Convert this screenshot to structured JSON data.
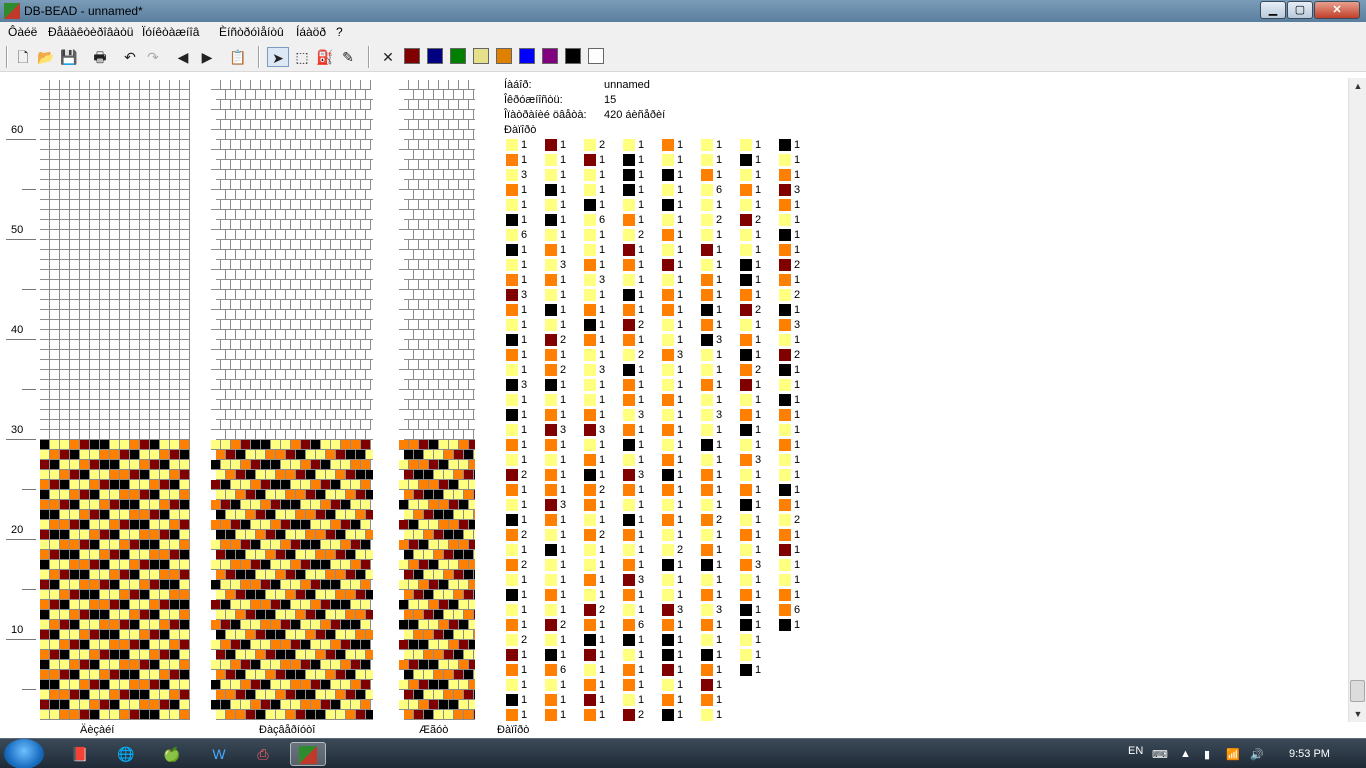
{
  "window": {
    "title": "DB-BEAD - unnamed*",
    "min_label": "▁",
    "max_label": "▢",
    "close_label": "✕"
  },
  "menu": [
    "Ôàéë",
    "Ðåäàêòèðîâàòü",
    "Ïóíêòàæíîâ",
    "Èíñòðóìåíòû",
    "Íáàöð",
    "?"
  ],
  "toolbar_icons": [
    "new-icon",
    "open-icon",
    "save-icon",
    "print-icon",
    "undo-icon",
    "redo-icon",
    "prev-icon",
    "next-icon",
    "paste-icon",
    "pointer-icon",
    "select-icon",
    "fill-icon",
    "eyedropper-icon",
    "clear-icon"
  ],
  "palette": [
    "#800000",
    "#000080",
    "#008000",
    "#e6e08a",
    "#e08000",
    "#0000ff",
    "#800080",
    "#000000",
    "#ffffff"
  ],
  "ruler": {
    "labels": [
      "60",
      "50",
      "40",
      "30",
      "20",
      "10"
    ]
  },
  "panels": {
    "draft_label": "Äèçàéí",
    "corrected_label": "Ðàçâåðíóòî",
    "rope_label": "Æãóò",
    "list_label": "Ðàïîðò"
  },
  "info": {
    "file_label": "Íàáîð:",
    "file_value": "unnamed",
    "circ_label": "Îêðóæíîñòü:",
    "circ_value": "15",
    "repeat_label": "Îïàòðàíèé öâåòà:",
    "repeat_value": "420 áèñåðèí",
    "list_header": "Ðàïîðò"
  },
  "colors": {
    "Y": "#ffff80",
    "O": "#ff8000",
    "R": "#800000",
    "K": "#000000"
  },
  "bead_list": [
    [
      [
        "Y",
        "1"
      ],
      [
        "O",
        "1"
      ],
      [
        "Y",
        "3"
      ],
      [
        "O",
        "1"
      ],
      [
        "Y",
        "1"
      ],
      [
        "K",
        "1"
      ],
      [
        "Y",
        "6"
      ],
      [
        "K",
        "1"
      ],
      [
        "Y",
        "1"
      ],
      [
        "O",
        "1"
      ],
      [
        "R",
        "3"
      ],
      [
        "O",
        "1"
      ],
      [
        "Y",
        "1"
      ],
      [
        "K",
        "1"
      ],
      [
        "O",
        "1"
      ],
      [
        "Y",
        "1"
      ],
      [
        "K",
        "3"
      ],
      [
        "Y",
        "1"
      ],
      [
        "K",
        "1"
      ],
      [
        "Y",
        "1"
      ],
      [
        "O",
        "1"
      ],
      [
        "Y",
        "1"
      ],
      [
        "R",
        "2"
      ],
      [
        "O",
        "1"
      ],
      [
        "Y",
        "1"
      ],
      [
        "K",
        "1"
      ],
      [
        "O",
        "2"
      ],
      [
        "Y",
        "1"
      ],
      [
        "O",
        "2"
      ],
      [
        "Y",
        "1"
      ],
      [
        "K",
        "1"
      ],
      [
        "Y",
        "1"
      ],
      [
        "O",
        "1"
      ],
      [
        "Y",
        "2"
      ],
      [
        "R",
        "1"
      ],
      [
        "O",
        "1"
      ],
      [
        "Y",
        "1"
      ],
      [
        "K",
        "1"
      ],
      [
        "O",
        "1"
      ]
    ],
    [
      [
        "R",
        "1"
      ],
      [
        "Y",
        "1"
      ],
      [
        "Y",
        "1"
      ],
      [
        "K",
        "1"
      ],
      [
        "Y",
        "1"
      ],
      [
        "K",
        "1"
      ],
      [
        "Y",
        "1"
      ],
      [
        "O",
        "1"
      ],
      [
        "Y",
        "3"
      ],
      [
        "O",
        "1"
      ],
      [
        "Y",
        "1"
      ],
      [
        "K",
        "1"
      ],
      [
        "Y",
        "1"
      ],
      [
        "R",
        "2"
      ],
      [
        "O",
        "1"
      ],
      [
        "O",
        "2"
      ],
      [
        "K",
        "1"
      ],
      [
        "Y",
        "1"
      ],
      [
        "O",
        "1"
      ],
      [
        "R",
        "3"
      ],
      [
        "O",
        "1"
      ],
      [
        "Y",
        "1"
      ],
      [
        "O",
        "1"
      ],
      [
        "O",
        "1"
      ],
      [
        "R",
        "3"
      ],
      [
        "O",
        "1"
      ],
      [
        "Y",
        "1"
      ],
      [
        "K",
        "1"
      ],
      [
        "Y",
        "1"
      ],
      [
        "Y",
        "1"
      ],
      [
        "O",
        "1"
      ],
      [
        "Y",
        "1"
      ],
      [
        "R",
        "2"
      ],
      [
        "Y",
        "1"
      ],
      [
        "K",
        "1"
      ],
      [
        "O",
        "6"
      ],
      [
        "Y",
        "1"
      ],
      [
        "O",
        "1"
      ],
      [
        "O",
        "1"
      ]
    ],
    [
      [
        "Y",
        "2"
      ],
      [
        "R",
        "1"
      ],
      [
        "Y",
        "1"
      ],
      [
        "Y",
        "1"
      ],
      [
        "K",
        "1"
      ],
      [
        "Y",
        "6"
      ],
      [
        "Y",
        "1"
      ],
      [
        "Y",
        "1"
      ],
      [
        "O",
        "1"
      ],
      [
        "Y",
        "3"
      ],
      [
        "Y",
        "1"
      ],
      [
        "O",
        "1"
      ],
      [
        "K",
        "1"
      ],
      [
        "O",
        "1"
      ],
      [
        "Y",
        "1"
      ],
      [
        "Y",
        "3"
      ],
      [
        "Y",
        "1"
      ],
      [
        "Y",
        "1"
      ],
      [
        "O",
        "1"
      ],
      [
        "R",
        "3"
      ],
      [
        "Y",
        "1"
      ],
      [
        "O",
        "1"
      ],
      [
        "K",
        "1"
      ],
      [
        "O",
        "2"
      ],
      [
        "O",
        "1"
      ],
      [
        "Y",
        "1"
      ],
      [
        "O",
        "2"
      ],
      [
        "Y",
        "1"
      ],
      [
        "Y",
        "1"
      ],
      [
        "O",
        "1"
      ],
      [
        "Y",
        "1"
      ],
      [
        "R",
        "2"
      ],
      [
        "O",
        "1"
      ],
      [
        "K",
        "1"
      ],
      [
        "R",
        "1"
      ],
      [
        "Y",
        "1"
      ],
      [
        "O",
        "1"
      ],
      [
        "R",
        "1"
      ],
      [
        "O",
        "1"
      ]
    ],
    [
      [
        "Y",
        "1"
      ],
      [
        "K",
        "1"
      ],
      [
        "K",
        "1"
      ],
      [
        "K",
        "1"
      ],
      [
        "Y",
        "1"
      ],
      [
        "O",
        "1"
      ],
      [
        "Y",
        "2"
      ],
      [
        "R",
        "1"
      ],
      [
        "O",
        "1"
      ],
      [
        "Y",
        "1"
      ],
      [
        "K",
        "1"
      ],
      [
        "O",
        "1"
      ],
      [
        "R",
        "2"
      ],
      [
        "O",
        "1"
      ],
      [
        "Y",
        "2"
      ],
      [
        "K",
        "1"
      ],
      [
        "O",
        "1"
      ],
      [
        "O",
        "1"
      ],
      [
        "Y",
        "3"
      ],
      [
        "O",
        "1"
      ],
      [
        "K",
        "1"
      ],
      [
        "Y",
        "1"
      ],
      [
        "R",
        "3"
      ],
      [
        "O",
        "1"
      ],
      [
        "Y",
        "1"
      ],
      [
        "K",
        "1"
      ],
      [
        "O",
        "1"
      ],
      [
        "Y",
        "1"
      ],
      [
        "O",
        "1"
      ],
      [
        "R",
        "3"
      ],
      [
        "O",
        "1"
      ],
      [
        "Y",
        "1"
      ],
      [
        "O",
        "6"
      ],
      [
        "K",
        "1"
      ],
      [
        "Y",
        "1"
      ],
      [
        "O",
        "1"
      ],
      [
        "O",
        "1"
      ],
      [
        "Y",
        "1"
      ],
      [
        "R",
        "2"
      ]
    ],
    [
      [
        "O",
        "1"
      ],
      [
        "Y",
        "1"
      ],
      [
        "K",
        "1"
      ],
      [
        "Y",
        "1"
      ],
      [
        "K",
        "1"
      ],
      [
        "Y",
        "1"
      ],
      [
        "O",
        "1"
      ],
      [
        "Y",
        "1"
      ],
      [
        "R",
        "1"
      ],
      [
        "Y",
        "1"
      ],
      [
        "O",
        "1"
      ],
      [
        "O",
        "1"
      ],
      [
        "Y",
        "1"
      ],
      [
        "Y",
        "1"
      ],
      [
        "O",
        "3"
      ],
      [
        "Y",
        "1"
      ],
      [
        "Y",
        "1"
      ],
      [
        "O",
        "1"
      ],
      [
        "Y",
        "1"
      ],
      [
        "O",
        "1"
      ],
      [
        "Y",
        "1"
      ],
      [
        "O",
        "1"
      ],
      [
        "K",
        "1"
      ],
      [
        "O",
        "1"
      ],
      [
        "Y",
        "1"
      ],
      [
        "O",
        "1"
      ],
      [
        "Y",
        "1"
      ],
      [
        "Y",
        "2"
      ],
      [
        "K",
        "1"
      ],
      [
        "Y",
        "1"
      ],
      [
        "Y",
        "1"
      ],
      [
        "R",
        "3"
      ],
      [
        "O",
        "1"
      ],
      [
        "K",
        "1"
      ],
      [
        "K",
        "1"
      ],
      [
        "R",
        "1"
      ],
      [
        "Y",
        "1"
      ],
      [
        "O",
        "1"
      ],
      [
        "K",
        "1"
      ]
    ],
    [
      [
        "Y",
        "1"
      ],
      [
        "Y",
        "1"
      ],
      [
        "O",
        "1"
      ],
      [
        "Y",
        "6"
      ],
      [
        "Y",
        "1"
      ],
      [
        "Y",
        "2"
      ],
      [
        "Y",
        "1"
      ],
      [
        "R",
        "1"
      ],
      [
        "Y",
        "1"
      ],
      [
        "O",
        "1"
      ],
      [
        "O",
        "1"
      ],
      [
        "K",
        "1"
      ],
      [
        "O",
        "1"
      ],
      [
        "K",
        "3"
      ],
      [
        "Y",
        "1"
      ],
      [
        "Y",
        "1"
      ],
      [
        "O",
        "1"
      ],
      [
        "Y",
        "1"
      ],
      [
        "Y",
        "3"
      ],
      [
        "Y",
        "1"
      ],
      [
        "K",
        "1"
      ],
      [
        "Y",
        "1"
      ],
      [
        "O",
        "1"
      ],
      [
        "O",
        "1"
      ],
      [
        "Y",
        "1"
      ],
      [
        "O",
        "2"
      ],
      [
        "Y",
        "1"
      ],
      [
        "O",
        "1"
      ],
      [
        "K",
        "1"
      ],
      [
        "Y",
        "1"
      ],
      [
        "O",
        "1"
      ],
      [
        "Y",
        "3"
      ],
      [
        "O",
        "1"
      ],
      [
        "Y",
        "1"
      ],
      [
        "K",
        "1"
      ],
      [
        "O",
        "1"
      ],
      [
        "R",
        "1"
      ],
      [
        "O",
        "1"
      ],
      [
        "Y",
        "1"
      ]
    ],
    [
      [
        "Y",
        "1"
      ],
      [
        "K",
        "1"
      ],
      [
        "Y",
        "1"
      ],
      [
        "O",
        "1"
      ],
      [
        "Y",
        "1"
      ],
      [
        "R",
        "2"
      ],
      [
        "Y",
        "1"
      ],
      [
        "Y",
        "1"
      ],
      [
        "K",
        "1"
      ],
      [
        "K",
        "1"
      ],
      [
        "O",
        "1"
      ],
      [
        "R",
        "2"
      ],
      [
        "Y",
        "1"
      ],
      [
        "O",
        "1"
      ],
      [
        "K",
        "1"
      ],
      [
        "O",
        "2"
      ],
      [
        "R",
        "1"
      ],
      [
        "Y",
        "1"
      ],
      [
        "O",
        "1"
      ],
      [
        "K",
        "1"
      ],
      [
        "Y",
        "1"
      ],
      [
        "O",
        "3"
      ],
      [
        "Y",
        "1"
      ],
      [
        "O",
        "1"
      ],
      [
        "K",
        "1"
      ],
      [
        "Y",
        "1"
      ],
      [
        "O",
        "1"
      ],
      [
        "Y",
        "1"
      ],
      [
        "O",
        "3"
      ],
      [
        "Y",
        "1"
      ],
      [
        "O",
        "1"
      ],
      [
        "K",
        "1"
      ],
      [
        "K",
        "1"
      ],
      [
        "Y",
        "1"
      ],
      [
        "Y",
        "1"
      ],
      [
        "K",
        "1"
      ]
    ],
    [
      [
        "K",
        "1"
      ],
      [
        "Y",
        "1"
      ],
      [
        "O",
        "1"
      ],
      [
        "R",
        "3"
      ],
      [
        "O",
        "1"
      ],
      [
        "Y",
        "1"
      ],
      [
        "K",
        "1"
      ],
      [
        "O",
        "1"
      ],
      [
        "R",
        "2"
      ],
      [
        "O",
        "1"
      ],
      [
        "Y",
        "2"
      ],
      [
        "K",
        "1"
      ],
      [
        "O",
        "3"
      ],
      [
        "Y",
        "1"
      ],
      [
        "R",
        "2"
      ],
      [
        "K",
        "1"
      ],
      [
        "Y",
        "1"
      ],
      [
        "K",
        "1"
      ],
      [
        "O",
        "1"
      ],
      [
        "Y",
        "1"
      ],
      [
        "O",
        "1"
      ],
      [
        "Y",
        "1"
      ],
      [
        "Y",
        "1"
      ],
      [
        "K",
        "1"
      ],
      [
        "O",
        "1"
      ],
      [
        "Y",
        "2"
      ],
      [
        "O",
        "1"
      ],
      [
        "R",
        "1"
      ],
      [
        "Y",
        "1"
      ],
      [
        "Y",
        "1"
      ],
      [
        "O",
        "1"
      ],
      [
        "O",
        "6"
      ],
      [
        "K",
        "1"
      ]
    ]
  ]
}
